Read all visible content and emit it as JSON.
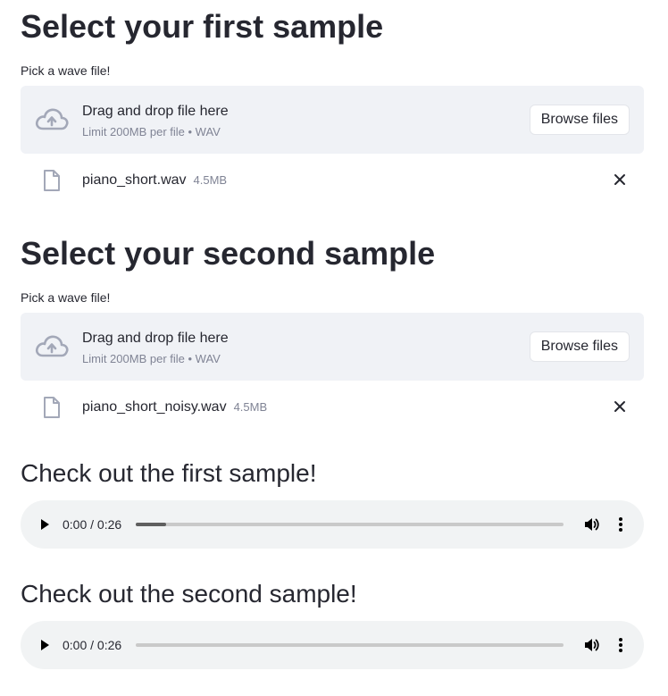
{
  "sections": [
    {
      "heading": "Select your first sample",
      "uploader": {
        "label": "Pick a wave file!",
        "drop_title": "Drag and drop file here",
        "drop_limit": "Limit 200MB per file • WAV",
        "browse_label": "Browse files",
        "icon": "cloud-upload-icon",
        "file": {
          "name": "piano_short.wav",
          "size": "4.5MB",
          "icon": "file-icon"
        }
      }
    },
    {
      "heading": "Select your second sample",
      "uploader": {
        "label": "Pick a wave file!",
        "drop_title": "Drag and drop file here",
        "drop_limit": "Limit 200MB per file • WAV",
        "browse_label": "Browse files",
        "icon": "cloud-upload-icon",
        "file": {
          "name": "piano_short_noisy.wav",
          "size": "4.5MB",
          "icon": "file-icon"
        }
      }
    }
  ],
  "players": [
    {
      "heading": "Check out the first sample!",
      "time": "0:00 / 0:26",
      "progress": 0.07
    },
    {
      "heading": "Check out the second sample!",
      "time": "0:00 / 0:26",
      "progress": 0
    }
  ],
  "colors": {
    "text": "#262730",
    "muted": "#808495",
    "icon": "#a3a8b8",
    "dropzone_bg": "#f0f2f6",
    "player_bg": "#f1f3f4"
  }
}
